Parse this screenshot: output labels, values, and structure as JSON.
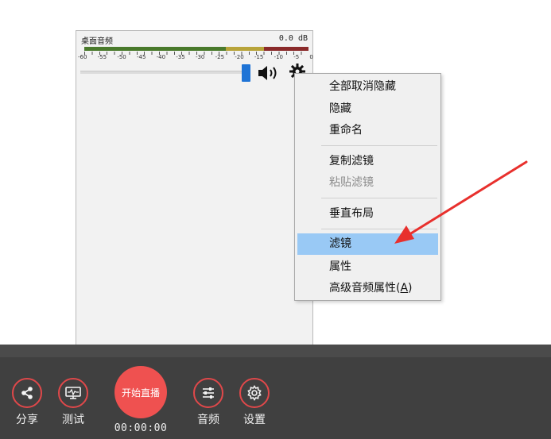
{
  "mixer": {
    "title": "桌面音频",
    "db_readout": "0.0 dB",
    "tick_labels": [
      "-60",
      "-55",
      "-50",
      "-45",
      "-40",
      "-35",
      "-30",
      "-25",
      "-20",
      "-15",
      "-10",
      "-5",
      "0"
    ],
    "volume_fraction": 1.0,
    "meter_colors": {
      "green": "#4a7a2c",
      "yellow": "#b8a43a",
      "red": "#8a2a2a"
    }
  },
  "context_menu": {
    "items": [
      {
        "label": "全部取消隐藏",
        "state": "normal"
      },
      {
        "label": "隐藏",
        "state": "normal"
      },
      {
        "label": "重命名",
        "state": "normal"
      },
      {
        "label": "复制滤镜",
        "state": "normal"
      },
      {
        "label": "粘贴滤镜",
        "state": "disabled"
      },
      {
        "label": "垂直布局",
        "state": "normal"
      },
      {
        "label": "滤镜",
        "state": "highlighted"
      },
      {
        "label": "属性",
        "state": "normal"
      },
      {
        "label": "高级音频属性",
        "accelerator_prefix": "(",
        "accelerator": "A",
        "accelerator_suffix": ")",
        "state": "normal"
      }
    ],
    "highlight_color": "#99c9f5"
  },
  "toolbar": {
    "share_label": "分享",
    "test_label": "测试",
    "live_label": "开始直播",
    "timer": "00:00:00",
    "audio_label": "音频",
    "settings_label": "设置",
    "accent_color": "#ef5150"
  },
  "icons": {
    "share": "share-icon",
    "test": "monitor-icon",
    "audio": "sliders-icon",
    "settings": "gear-icon",
    "speaker": "speaker-icon"
  }
}
